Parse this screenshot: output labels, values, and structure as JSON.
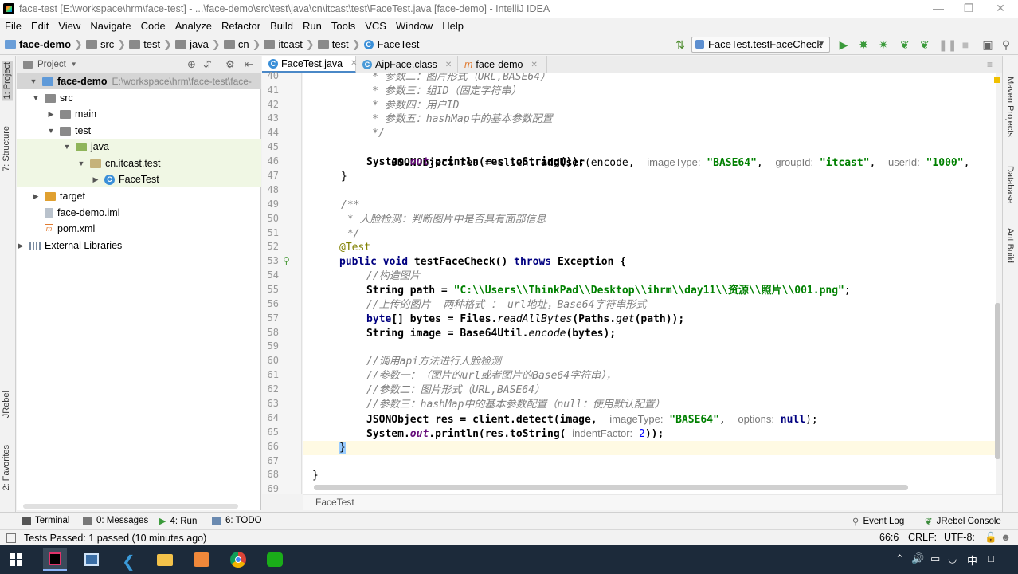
{
  "window": {
    "title": "face-test [E:\\workspace\\hrm\\face-test] - ...\\face-demo\\src\\test\\java\\cn\\itcast\\test\\FaceTest.java [face-demo] - IntelliJ IDEA"
  },
  "menu": [
    "File",
    "Edit",
    "View",
    "Navigate",
    "Code",
    "Analyze",
    "Refactor",
    "Build",
    "Run",
    "Tools",
    "VCS",
    "Window",
    "Help"
  ],
  "breadcrumb": [
    "face-demo",
    "src",
    "test",
    "java",
    "cn",
    "itcast",
    "test",
    "FaceTest"
  ],
  "run_config": "FaceTest.testFaceCheck",
  "left_tabs": [
    "1: Project",
    "7: Structure",
    "JRebel",
    "2: Favorites"
  ],
  "right_tabs": [
    "Maven Projects",
    "Database",
    "Ant Build"
  ],
  "project_panel": {
    "title": "Project",
    "tree": [
      {
        "label": "face-demo",
        "path": "E:\\workspace\\hrm\\face-test\\face-"
      },
      {
        "label": "src"
      },
      {
        "label": "main"
      },
      {
        "label": "test"
      },
      {
        "label": "java"
      },
      {
        "label": "cn.itcast.test"
      },
      {
        "label": "FaceTest"
      },
      {
        "label": "target"
      },
      {
        "label": "face-demo.iml"
      },
      {
        "label": "pom.xml"
      },
      {
        "label": "External Libraries"
      }
    ]
  },
  "editor_tabs": [
    "FaceTest.java",
    "AipFace.class",
    "face-demo"
  ],
  "line_numbers": [
    "40",
    "41",
    "42",
    "43",
    "44",
    "45",
    "46",
    "47",
    "48",
    "49",
    "50",
    "51",
    "52",
    "53",
    "54",
    "55",
    "56",
    "57",
    "58",
    "59",
    "60",
    "61",
    "62",
    "63",
    "64",
    "65",
    "66",
    "67",
    "68",
    "69"
  ],
  "code": {
    "l40": "     * 参数二：图片形式（URL,BASE64）",
    "l41": "     * 参数三：组ID（固定字符串）",
    "l42": "     * 参数四：用户ID",
    "l43": "     * 参数五：hashMap中的基本参数配置",
    "l44": "     */",
    "l45_a": "JSONObject",
    "l45_b": " res = client.",
    "l45_c": "addUser",
    "l45_d": "(encode,",
    "l45_h1": "imageType:",
    "l45_s1": "\"BASE64\"",
    "l45_h2": "groupId:",
    "l45_s2": "\"itcast\"",
    "l45_h3": "userId:",
    "l45_s3": "\"1000\"",
    "l46_a": "System.",
    "l46_b": "out",
    "l46_c": ".println(res.toString());",
    "l47": "}",
    "l49": "/**",
    "l50": " * 人脸检测：判断图片中是否具有面部信息",
    "l51": " */",
    "l52": "@Test",
    "l53_a": "public void",
    "l53_b": " testFaceCheck() ",
    "l53_c": "throws",
    "l53_d": " Exception {",
    "l54": "//构造图片",
    "l55_a": "String",
    "l55_b": " path = ",
    "l55_c": "\"C:\\\\Users\\\\ThinkPad\\\\Desktop\\\\ihrm\\\\day11\\\\资源\\\\照片\\\\001.png\"",
    "l55_d": ";",
    "l56": "//上传的图片  两种格式 ： url地址，Base64字符串形式",
    "l57_a": "byte",
    "l57_b": "[] bytes = Files.",
    "l57_c": "readAllBytes",
    "l57_d": "(Paths.",
    "l57_e": "get",
    "l57_f": "(path));",
    "l58_a": "String",
    "l58_b": " image = Base64Util.",
    "l58_c": "encode",
    "l58_d": "(bytes);",
    "l60": "//调用api方法进行人脸检测",
    "l61": "//参数一：（图片的url或者图片的Base64字符串），",
    "l62": "//参数二：图片形式（URL,BASE64）",
    "l63": "//参数三：hashMap中的基本参数配置（null：使用默认配置）",
    "l64_a": "JSONObject",
    "l64_b": " res = client.detect(image,",
    "l64_h1": "imageType:",
    "l64_s1": "\"BASE64\"",
    "l64_h2": "options:",
    "l64_k": "null",
    "l64_e": ");",
    "l65_a": "System.",
    "l65_b": "out",
    "l65_c": ".println(res.toString(",
    "l65_h": "indentFactor:",
    "l65_n": "2",
    "l65_e": "));",
    "l66": "}",
    "l68": "}"
  },
  "editor_breadcrumb": "FaceTest",
  "bottom_tools": [
    "Terminal",
    "0: Messages",
    "4: Run",
    "6: TODO",
    "Event Log",
    "JRebel Console"
  ],
  "status": {
    "message": "Tests Passed: 1 passed (10 minutes ago)",
    "position": "66:6",
    "line_sep": "CRLF:",
    "encoding": "UTF-8:"
  },
  "colors": {
    "keyword": "#000080",
    "string": "#008000",
    "comment": "#808080",
    "annotation": "#808000",
    "taskbar": "#1c2a3a"
  }
}
